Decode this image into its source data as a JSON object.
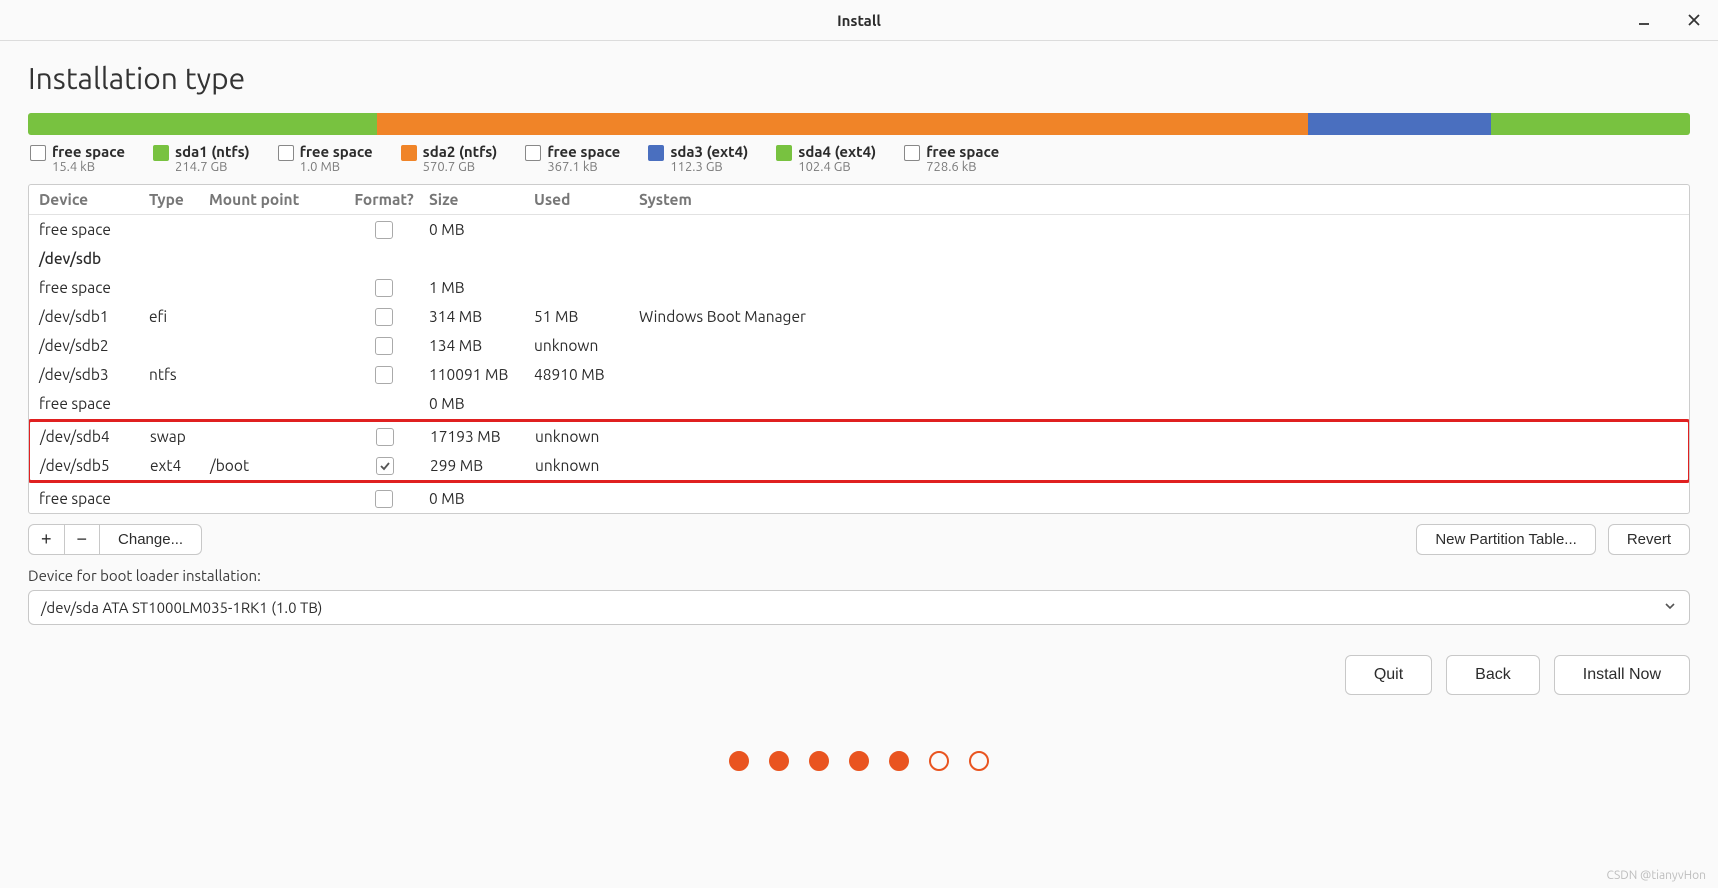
{
  "window_title": "Install",
  "page_title": "Installation type",
  "colors": {
    "green": "#78c240",
    "orange": "#f08428",
    "blue": "#4a6fbf",
    "white": "#ffffff"
  },
  "partbar": [
    {
      "color": "green",
      "flex": 21
    },
    {
      "color": "orange",
      "flex": 56
    },
    {
      "color": "blue",
      "flex": 11
    },
    {
      "color": "green",
      "flex": 12
    }
  ],
  "legend": [
    {
      "color": "white",
      "name": "free space",
      "size": "15.4 kB"
    },
    {
      "color": "green",
      "name": "sda1 (ntfs)",
      "size": "214.7 GB"
    },
    {
      "color": "white",
      "name": "free space",
      "size": "1.0 MB"
    },
    {
      "color": "orange",
      "name": "sda2 (ntfs)",
      "size": "570.7 GB"
    },
    {
      "color": "white",
      "name": "free space",
      "size": "367.1 kB"
    },
    {
      "color": "blue",
      "name": "sda3 (ext4)",
      "size": "112.3 GB"
    },
    {
      "color": "green",
      "name": "sda4 (ext4)",
      "size": "102.4 GB"
    },
    {
      "color": "white",
      "name": "free space",
      "size": "728.6 kB"
    }
  ],
  "table": {
    "headers": {
      "device": "Device",
      "type": "Type",
      "mount": "Mount point",
      "format": "Format?",
      "size": "Size",
      "used": "Used",
      "system": "System"
    },
    "rows": [
      {
        "device": "free space",
        "type": "",
        "mount": "",
        "format": "box",
        "size": "0 MB",
        "used": "",
        "system": ""
      },
      {
        "device": "/dev/sdb",
        "disk": true
      },
      {
        "device": "free space",
        "type": "",
        "mount": "",
        "format": "box",
        "size": "1 MB",
        "used": "",
        "system": ""
      },
      {
        "device": "/dev/sdb1",
        "type": "efi",
        "mount": "",
        "format": "box",
        "size": "314 MB",
        "used": "51 MB",
        "system": "Windows Boot Manager"
      },
      {
        "device": "/dev/sdb2",
        "type": "",
        "mount": "",
        "format": "box",
        "size": "134 MB",
        "used": "unknown",
        "system": ""
      },
      {
        "device": "/dev/sdb3",
        "type": "ntfs",
        "mount": "",
        "format": "box",
        "size": "110091 MB",
        "used": "48910 MB",
        "system": ""
      },
      {
        "device": "free space",
        "type": "",
        "mount": "",
        "format": "none",
        "size": "0 MB",
        "used": "",
        "system": ""
      },
      {
        "device": "/dev/sdb4",
        "type": "swap",
        "mount": "",
        "format": "box",
        "size": "17193 MB",
        "used": "unknown",
        "system": "",
        "hl": true
      },
      {
        "device": "/dev/sdb5",
        "type": "ext4",
        "mount": "/boot",
        "format": "checked",
        "size": "299 MB",
        "used": "unknown",
        "system": "",
        "hl": true
      },
      {
        "device": "free space",
        "type": "",
        "mount": "",
        "format": "box",
        "size": "0 MB",
        "used": "",
        "system": ""
      }
    ]
  },
  "toolbar": {
    "add": "+",
    "remove": "−",
    "change": "Change...",
    "new_table": "New Partition Table...",
    "revert": "Revert"
  },
  "bootloader": {
    "label": "Device for boot loader installation:",
    "value": "/dev/sda   ATA ST1000LM035-1RK1 (1.0 TB)"
  },
  "nav": {
    "quit": "Quit",
    "back": "Back",
    "install": "Install Now"
  },
  "progress": {
    "total": 7,
    "filled": 5
  },
  "watermark": "CSDN @tianyvHon"
}
